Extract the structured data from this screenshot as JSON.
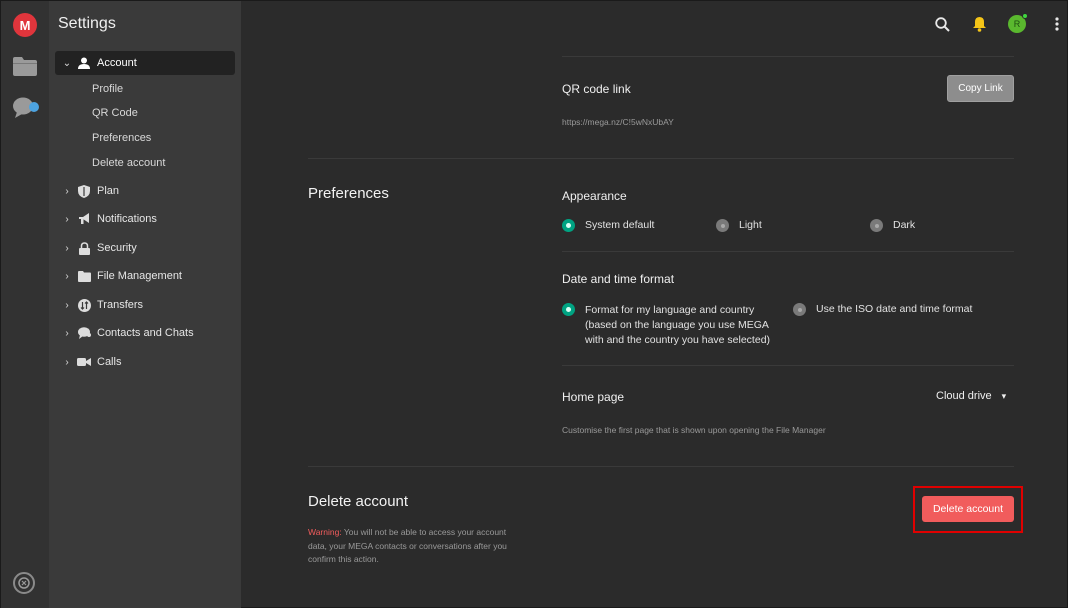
{
  "app": {
    "title": "Settings",
    "logo_letter": "M"
  },
  "topbar": {
    "avatar_letter": "R"
  },
  "sidebar": {
    "account": {
      "label": "Account",
      "subitems": [
        "Profile",
        "QR Code",
        "Preferences",
        "Delete account"
      ]
    },
    "items": [
      "Plan",
      "Notifications",
      "Security",
      "File Management",
      "Transfers",
      "Contacts and Chats",
      "Calls"
    ]
  },
  "qr": {
    "label": "QR code link",
    "url": "https://mega.nz/C!5wNxUbAY",
    "copy_button": "Copy Link"
  },
  "preferences": {
    "title": "Preferences",
    "appearance": {
      "label": "Appearance",
      "options": [
        "System default",
        "Light",
        "Dark"
      ],
      "selected": "System default"
    },
    "datetime": {
      "label": "Date and time format",
      "option_1_line1": "Format for my language and country",
      "option_1_line2": "(based on the language you use MEGA",
      "option_1_line3": "with and the country you have selected)",
      "option_2": "Use the ISO date and time format",
      "selected": "Format for my language and country"
    },
    "homepage": {
      "label": "Home page",
      "value": "Cloud drive",
      "description": "Customise the first page that is shown upon opening the File Manager"
    }
  },
  "delete_account": {
    "title": "Delete account",
    "button": "Delete account",
    "warning_label": "Warning:",
    "warning_line1": " You will not be able to access your account",
    "warning_line2": "data, your MEGA contacts or conversations after you",
    "warning_line3": "confirm this action."
  },
  "colors": {
    "accent_green": "#00a382",
    "danger": "#f15c5c",
    "highlight": "#e00000"
  }
}
